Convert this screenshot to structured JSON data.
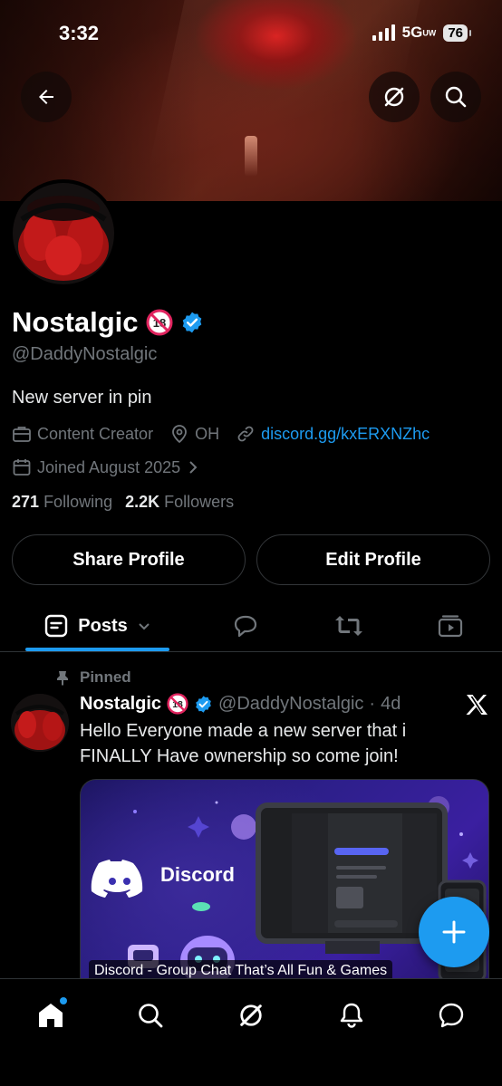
{
  "status": {
    "time": "3:32",
    "network": "5G",
    "network_suffix": "UW",
    "battery": "76"
  },
  "profile": {
    "name": "Nostalgic",
    "handle": "@DaddyNostalgic",
    "bio": "New server in pin",
    "category": "Content Creator",
    "location": "OH",
    "link": "discord.gg/kxERXNZhc",
    "joined": "Joined August 2025",
    "following_count": "271",
    "following_label": "Following",
    "followers_count": "2.2K",
    "followers_label": "Followers"
  },
  "buttons": {
    "share": "Share Profile",
    "edit": "Edit Profile"
  },
  "tabs": {
    "posts": "Posts"
  },
  "post": {
    "pinned_label": "Pinned",
    "author": "Nostalgic",
    "handle": "@DaddyNostalgic",
    "separator": "·",
    "age": "4d",
    "text": "Hello Everyone made a new server that i FINALLY Have ownership so come join!",
    "card_logo_text": "Discord",
    "card_caption": "Discord - Group Chat That’s All Fun & Games"
  },
  "colors": {
    "accent": "#1d9bf0",
    "muted": "#71767b",
    "border": "#2f3336"
  }
}
